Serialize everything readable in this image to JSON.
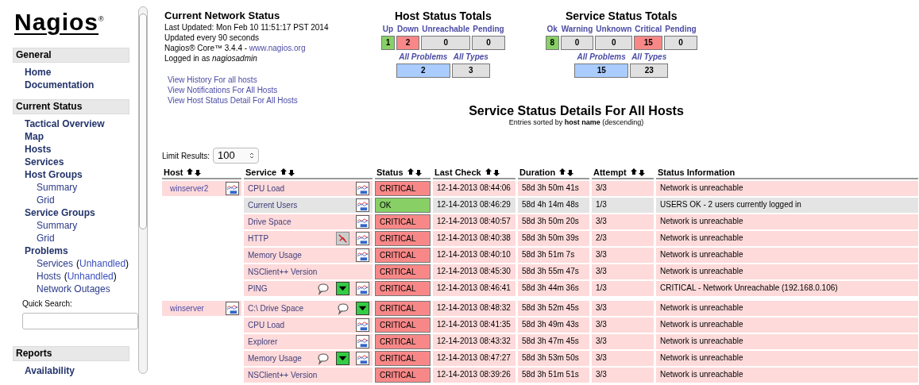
{
  "sidebar": {
    "logo": "Nagios",
    "logo_mark": "®",
    "sections": [
      {
        "title": "General",
        "items": [
          {
            "label": "Home"
          },
          {
            "label": "Documentation"
          }
        ]
      },
      {
        "title": "Current Status",
        "items": [
          {
            "label": "Tactical Overview"
          },
          {
            "label": "Map"
          },
          {
            "label": "Hosts"
          },
          {
            "label": "Services"
          },
          {
            "label": "Host Groups",
            "children": [
              {
                "label": "Summary"
              },
              {
                "label": "Grid"
              }
            ]
          },
          {
            "label": "Service Groups",
            "children": [
              {
                "label": "Summary"
              },
              {
                "label": "Grid"
              }
            ]
          },
          {
            "label": "Problems",
            "children": [
              {
                "label": "Services",
                "open": "(",
                "link": "Unhandled",
                "close": ")"
              },
              {
                "label": "Hosts",
                "open": "(",
                "link": "Unhandled",
                "close": ")"
              },
              {
                "label": "Network Outages"
              }
            ]
          }
        ],
        "search": {
          "label": "Quick Search:"
        }
      },
      {
        "title": "Reports",
        "items": [
          {
            "label": "Availability"
          }
        ]
      }
    ]
  },
  "status": {
    "title": "Current Network Status",
    "lines": [
      "Last Updated: Mon Feb 10 11:51:17 PST 2014",
      "Updated every 90 seconds"
    ],
    "version": "Nagios® Core™ 3.4.4 - ",
    "site": "www.nagios.org",
    "login": "Logged in as ",
    "user": "nagiosadmin",
    "links": [
      "View History For all hosts",
      "View Notifications For All Hosts",
      "View Host Status Detail For All Hosts"
    ]
  },
  "host_totals": {
    "title": "Host Status Totals",
    "counts": [
      {
        "label": "Up",
        "value": "1",
        "color": "#88d066"
      },
      {
        "label": "Down",
        "value": "2",
        "color": "#f88888"
      },
      {
        "label": "Unreachable",
        "value": "0",
        "color": "#e0e0e0"
      },
      {
        "label": "Pending",
        "value": "0",
        "color": "#e0e0e0"
      }
    ],
    "summary": [
      {
        "label": "All Problems",
        "value": "2",
        "color": "#aaccff"
      },
      {
        "label": "All Types",
        "value": "3",
        "color": "#e0e0e0"
      }
    ]
  },
  "service_totals": {
    "title": "Service Status Totals",
    "counts": [
      {
        "label": "Ok",
        "value": "8",
        "color": "#88d066"
      },
      {
        "label": "Warning",
        "value": "0",
        "color": "#e0e0e0"
      },
      {
        "label": "Unknown",
        "value": "0",
        "color": "#e0e0e0"
      },
      {
        "label": "Critical",
        "value": "15",
        "color": "#f88888"
      },
      {
        "label": "Pending",
        "value": "0",
        "color": "#e0e0e0"
      }
    ],
    "summary": [
      {
        "label": "All Problems",
        "value": "15",
        "color": "#aaccff"
      },
      {
        "label": "All Types",
        "value": "23",
        "color": "#e0e0e0"
      }
    ]
  },
  "details": {
    "title": "Service Status Details For All Hosts",
    "subtitle": "Entries sorted by **host name** (descending)",
    "limit_label": "Limit Results:",
    "limit_value": "100",
    "columns": [
      {
        "label": "Host",
        "sortable": true
      },
      {
        "label": "Service",
        "sortable": true
      },
      {
        "label": "Status",
        "sortable": true
      },
      {
        "label": "Last Check",
        "sortable": true
      },
      {
        "label": "Duration",
        "sortable": true
      },
      {
        "label": "Attempt",
        "sortable": true
      },
      {
        "label": "Status Information",
        "sortable": false
      }
    ],
    "hosts": [
      {
        "name": "winserver2",
        "graph": true,
        "services": [
          {
            "name": "CPU Load",
            "notifications_off": false,
            "comment": false,
            "passive": false,
            "graph": true,
            "status": "CRITICAL",
            "kind": "critical",
            "last_check": "12-14-2013 08:44:06",
            "duration": "58d 3h 50m 41s",
            "attempt": "3/3",
            "info": "Network is unreachable"
          },
          {
            "name": "Current Users",
            "notifications_off": false,
            "comment": false,
            "passive": false,
            "graph": true,
            "status": "OK",
            "kind": "ok",
            "last_check": "12-14-2013 08:46:29",
            "duration": "58d 4h 14m 48s",
            "attempt": "1/3",
            "info": "USERS OK - 2 users currently logged in"
          },
          {
            "name": "Drive Space",
            "notifications_off": false,
            "comment": false,
            "passive": false,
            "graph": true,
            "status": "CRITICAL",
            "kind": "critical",
            "last_check": "12-14-2013 08:40:57",
            "duration": "58d 3h 50m 20s",
            "attempt": "3/3",
            "info": "Network is unreachable"
          },
          {
            "name": "HTTP",
            "notifications_off": true,
            "comment": false,
            "passive": false,
            "graph": true,
            "status": "CRITICAL",
            "kind": "critical",
            "last_check": "12-14-2013 08:40:38",
            "duration": "58d 3h 50m 39s",
            "attempt": "2/3",
            "info": "Network is unreachable"
          },
          {
            "name": "Memory Usage",
            "notifications_off": false,
            "comment": false,
            "passive": false,
            "graph": true,
            "status": "CRITICAL",
            "kind": "critical",
            "last_check": "12-14-2013 08:40:10",
            "duration": "58d 3h 51m 7s",
            "attempt": "3/3",
            "info": "Network is unreachable"
          },
          {
            "name": "NSClient++ Version",
            "notifications_off": false,
            "comment": false,
            "passive": false,
            "graph": false,
            "status": "CRITICAL",
            "kind": "critical",
            "last_check": "12-14-2013 08:45:30",
            "duration": "58d 3h 55m 47s",
            "attempt": "3/3",
            "info": "Network is unreachable"
          },
          {
            "name": "PING",
            "notifications_off": false,
            "comment": true,
            "passive": true,
            "graph": true,
            "status": "CRITICAL",
            "kind": "critical",
            "last_check": "12-14-2013 08:46:41",
            "duration": "58d 3h 44m 36s",
            "attempt": "1/3",
            "info": "CRITICAL - Network Unreachable (192.168.0.106)"
          }
        ]
      },
      {
        "name": "winserver",
        "graph": true,
        "services": [
          {
            "name": "C:\\ Drive Space",
            "notifications_off": false,
            "comment": true,
            "passive": true,
            "graph": false,
            "status": "CRITICAL",
            "kind": "critical",
            "last_check": "12-14-2013 08:48:32",
            "duration": "58d 3h 52m 45s",
            "attempt": "3/3",
            "info": "Network is unreachable"
          },
          {
            "name": "CPU Load",
            "notifications_off": false,
            "comment": false,
            "passive": false,
            "graph": true,
            "status": "CRITICAL",
            "kind": "critical",
            "last_check": "12-14-2013 08:41:35",
            "duration": "58d 3h 49m 43s",
            "attempt": "3/3",
            "info": "Network is unreachable"
          },
          {
            "name": "Explorer",
            "notifications_off": false,
            "comment": false,
            "passive": false,
            "graph": true,
            "status": "CRITICAL",
            "kind": "critical",
            "last_check": "12-14-2013 08:43:32",
            "duration": "58d 3h 47m 45s",
            "attempt": "3/3",
            "info": "Network is unreachable"
          },
          {
            "name": "Memory Usage",
            "notifications_off": false,
            "comment": true,
            "passive": true,
            "graph": true,
            "status": "CRITICAL",
            "kind": "critical",
            "last_check": "12-14-2013 08:47:27",
            "duration": "58d 3h 53m 50s",
            "attempt": "3/3",
            "info": "Network is unreachable"
          },
          {
            "name": "NSClient++ Version",
            "notifications_off": false,
            "comment": false,
            "passive": false,
            "graph": false,
            "status": "CRITICAL",
            "kind": "critical",
            "last_check": "12-14-2013 08:39:26",
            "duration": "58d 3h 51m 51s",
            "attempt": "3/3",
            "info": "Network is unreachable"
          }
        ]
      }
    ]
  }
}
